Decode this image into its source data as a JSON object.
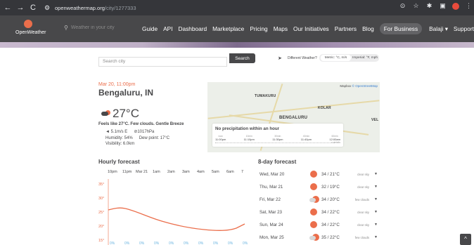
{
  "browser": {
    "url_host": "openweathermap.org",
    "url_path": "/city/1277333",
    "back": "←",
    "forward": "→",
    "reload": "C"
  },
  "header": {
    "logo_text": "OpenWeather",
    "search_placeholder": "Weather in your city",
    "menu": [
      "Guide",
      "API",
      "Dashboard",
      "Marketplace",
      "Pricing",
      "Maps",
      "Our Initiatives",
      "Partners",
      "Blog"
    ],
    "business": "For Business",
    "user": "Balaji ▾",
    "support": "Support ▾"
  },
  "search": {
    "placeholder": "Search city",
    "button": "Search",
    "different_weather": "Different Weather?",
    "metric": "Metric: °C, m/s",
    "imperial": "Imperial: °F, mph"
  },
  "current": {
    "date": "Mar 20, 11:00pm",
    "city": "Bengaluru, IN",
    "temp": "27°C",
    "feels": "Feels like 27°C. Few clouds. Gentle Breeze",
    "wind": "5.1m/s E",
    "pressure": "1017hPa",
    "humidity": "Humidity: 54%",
    "dew": "Dew point: 17°C",
    "visibility": "Visibility: 6.0km"
  },
  "map": {
    "attribution_1": "Mapbox",
    "attribution_2": "© OpenStreetMap",
    "labels": [
      "TUMAKURU",
      "KOLAR",
      "BENGALURU",
      "VEL"
    ],
    "precip_title": "No precipitation within an hour",
    "precip_times": [
      {
        "n": "now",
        "v": "11:00pm"
      },
      {
        "n": "10min",
        "v": "11:10pm"
      },
      {
        "n": "30min",
        "v": "11:30pm"
      },
      {
        "n": "40min",
        "v": "11:40pm"
      },
      {
        "n": "60min",
        "v": "12:00am"
      }
    ],
    "precip_details": "» details"
  },
  "hourly": {
    "title": "Hourly forecast",
    "hours": [
      "10pm",
      "11pm",
      "Mar 21",
      "1am",
      "2am",
      "3am",
      "4am",
      "5am",
      "6am",
      "7"
    ],
    "y_labels": [
      "35°",
      "30°",
      "25°",
      "20°",
      "15°"
    ],
    "precip": [
      "0%",
      "0%",
      "0%",
      "0%",
      "0%",
      "0%",
      "0%",
      "0%",
      "0%",
      "0%"
    ]
  },
  "eight_day": {
    "title": "8-day forecast",
    "days": [
      {
        "day": "Wed, Mar 20",
        "temp": "34 / 21°C",
        "desc": "clear sky",
        "icon": "sun"
      },
      {
        "day": "Thu, Mar 21",
        "temp": "32 / 19°C",
        "desc": "clear sky",
        "icon": "sun"
      },
      {
        "day": "Fri, Mar 22",
        "temp": "34 / 20°C",
        "desc": "few clouds",
        "icon": "cloud-sun"
      },
      {
        "day": "Sat, Mar 23",
        "temp": "34 / 22°C",
        "desc": "clear sky",
        "icon": "sun"
      },
      {
        "day": "Sun, Mar 24",
        "temp": "34 / 22°C",
        "desc": "clear sky",
        "icon": "sun"
      },
      {
        "day": "Mon, Mar 25",
        "temp": "35 / 22°C",
        "desc": "few clouds",
        "icon": "cloud-sun"
      }
    ]
  }
}
